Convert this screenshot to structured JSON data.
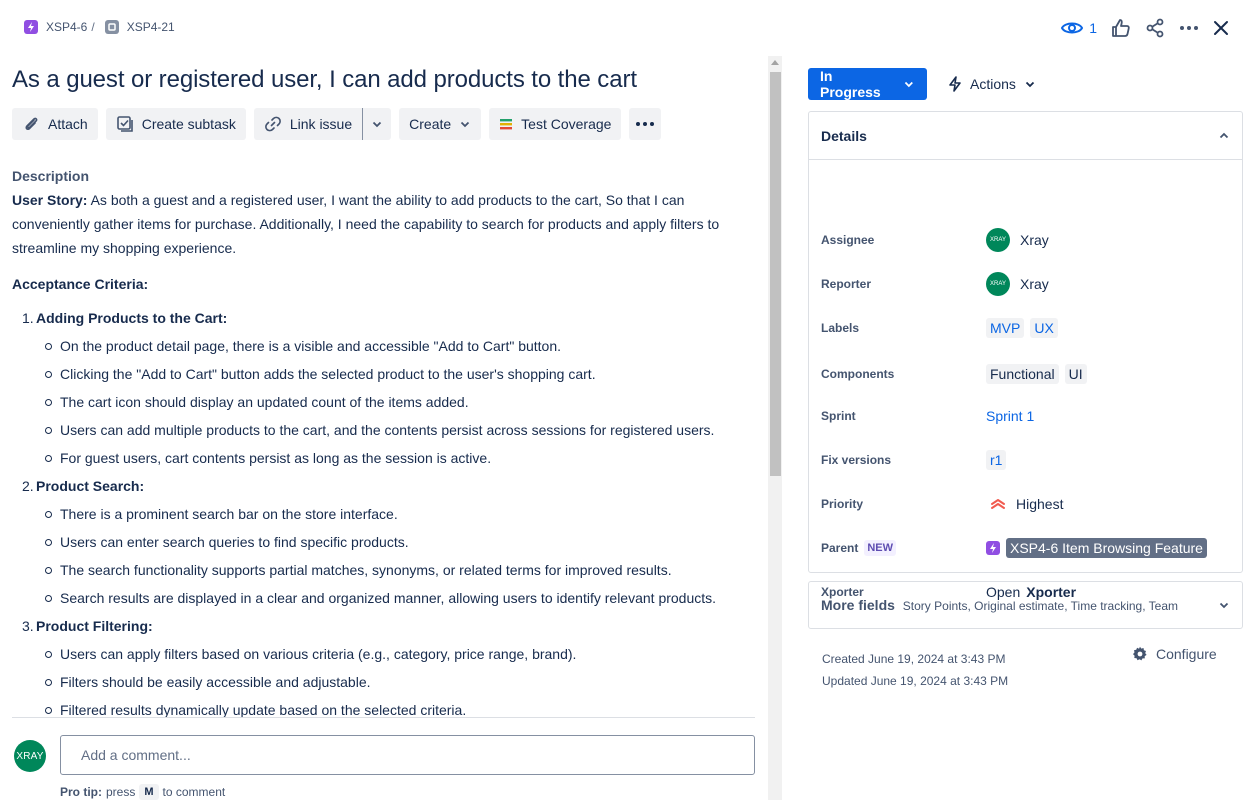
{
  "breadcrumbs": [
    {
      "key": "XSP4-6"
    },
    {
      "key": "XSP4-21"
    }
  ],
  "breadcrumb_sep": "/",
  "header_actions": {
    "watch_count": "1"
  },
  "issue": {
    "title": "As a guest or registered user, I can add products to the cart"
  },
  "toolbar": {
    "attach": "Attach",
    "create_subtask": "Create subtask",
    "link_issue": "Link issue",
    "create": "Create",
    "test_coverage": "Test Coverage"
  },
  "description": {
    "label": "Description",
    "user_story_label": "User Story:",
    "user_story_text": " As both a guest and a registered user, I want the ability to add products to the cart, So that I can conveniently gather items for purchase. Additionally, I need the capability to search for products and apply filters to streamline my shopping experience.",
    "acceptance_label": "Acceptance Criteria:",
    "sections": [
      {
        "num": "1.",
        "title": "Adding Products to the Cart:",
        "items": [
          "On the product detail page, there is a visible and accessible \"Add to Cart\" button.",
          "Clicking the \"Add to Cart\" button adds the selected product to the user's shopping cart.",
          "The cart icon should display an updated count of the items added.",
          "Users can add multiple products to the cart, and the contents persist across sessions for registered users.",
          "For guest users, cart contents persist as long as the session is active."
        ]
      },
      {
        "num": "2.",
        "title": "Product Search:",
        "items": [
          "There is a prominent search bar on the store interface.",
          "Users can enter search queries to find specific products.",
          "The search functionality supports partial matches, synonyms, or related terms for improved results.",
          "Search results are displayed in a clear and organized manner, allowing users to identify relevant products."
        ]
      },
      {
        "num": "3.",
        "title": "Product Filtering:",
        "items": [
          "Users can apply filters based on various criteria (e.g., category, price range, brand).",
          "Filters should be easily accessible and adjustable.",
          "Filtered results dynamically update based on the selected criteria."
        ]
      }
    ]
  },
  "comment": {
    "avatar_text": "XRAY",
    "placeholder": "Add a comment...",
    "pro_tip_label": "Pro tip:",
    "pro_tip_press": "press",
    "pro_tip_key": "M",
    "pro_tip_suffix": "to comment"
  },
  "status": {
    "label": "In Progress",
    "actions": "Actions"
  },
  "details": {
    "header": "Details",
    "assignee_label": "Assignee",
    "assignee_avatar": "XRAY",
    "assignee": "Xray",
    "reporter_label": "Reporter",
    "reporter_avatar": "XRAY",
    "reporter": "Xray",
    "labels_label": "Labels",
    "labels": [
      "MVP",
      "UX"
    ],
    "components_label": "Components",
    "components": [
      "Functional",
      "UI"
    ],
    "sprint_label": "Sprint",
    "sprint": "Sprint 1",
    "fix_versions_label": "Fix versions",
    "fix_version": "r1",
    "priority_label": "Priority",
    "priority": "Highest",
    "parent_label": "Parent",
    "parent_badge": "NEW",
    "parent": "XSP4-6 Item Browsing Feature",
    "xporter_label": "Xporter",
    "xporter_open": "Open",
    "xporter_name": "Xporter"
  },
  "more_fields": {
    "title": "More fields",
    "subtitle": "Story Points, Original estimate, Time tracking, Team"
  },
  "meta": {
    "created": "Created June 19, 2024 at 3:43 PM",
    "updated": "Updated June 19, 2024 at 3:43 PM",
    "configure": "Configure"
  },
  "colors": {
    "primary": "#0c66e4",
    "epic": "#904ee2",
    "avatar": "#00875a",
    "priority": "#f15b50"
  }
}
